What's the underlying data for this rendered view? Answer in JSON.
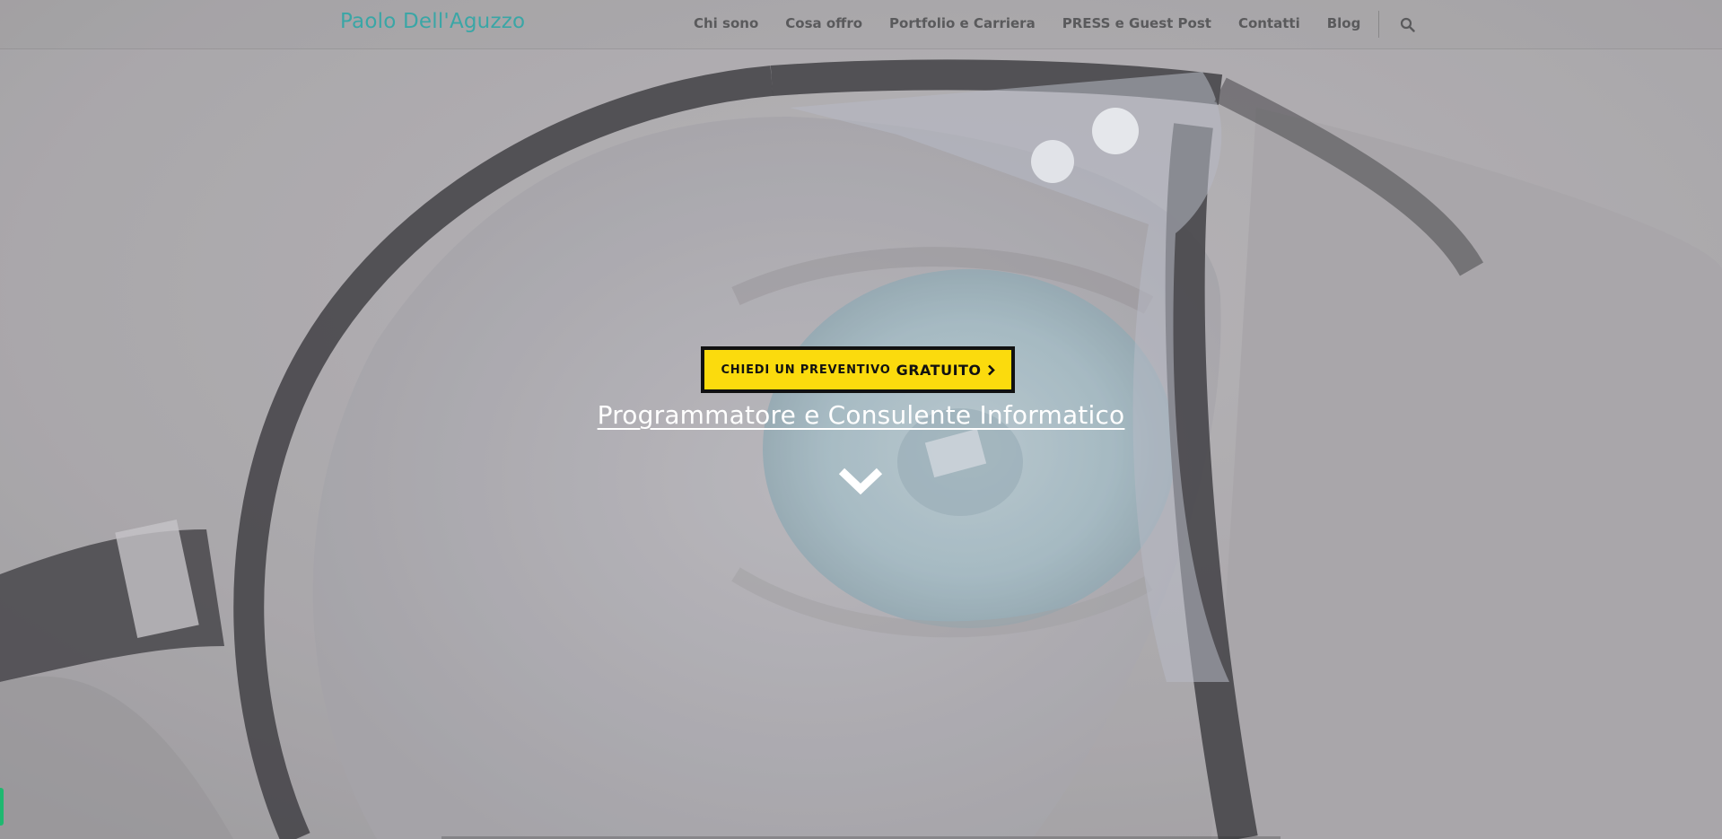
{
  "header": {
    "brand": "Paolo Dell'Aguzzo",
    "nav": [
      {
        "label": "Chi sono"
      },
      {
        "label": "Cosa offro"
      },
      {
        "label": "Portfolio e Carriera"
      },
      {
        "label": "PRESS e Guest Post"
      },
      {
        "label": "Contatti"
      },
      {
        "label": "Blog"
      }
    ],
    "search_icon": "search-icon"
  },
  "hero": {
    "cta_small": "CHIEDI UN PREVENTIVO",
    "cta_big": "GRATUITO",
    "cta_icon": "chevron-right-icon",
    "subtitle": "Programmatore e Consulente Informatico",
    "scroll_icon": "chevron-down-icon",
    "background": "close-up photo of an eye behind black-framed glasses"
  },
  "colors": {
    "brand": "#3aa6a6",
    "cta_background": "#fbdb0d",
    "cta_border": "#111111",
    "nav_text": "#5a5a5c",
    "badge": "#1fb870"
  }
}
